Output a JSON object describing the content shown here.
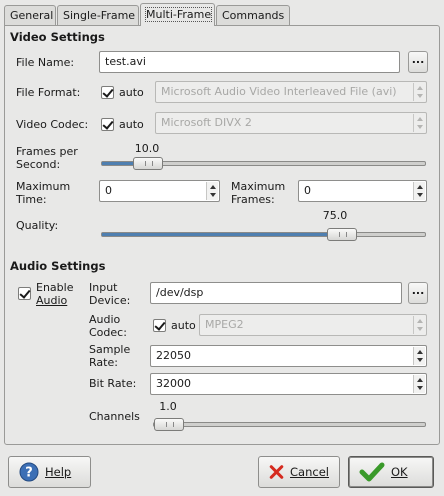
{
  "tabs": [
    "General",
    "Single-Frame",
    "Multi-Frame",
    "Commands"
  ],
  "video": {
    "title": "Video Settings",
    "file_name_label": "File Name:",
    "file_name_value": "test.avi",
    "browse_label": "...",
    "file_format_label": "File Format:",
    "auto_label": "auto",
    "file_format_value": "Microsoft Audio Video Interleaved File (avi)",
    "codec_label": "Video Codec:",
    "codec_value": "Microsoft DIVX 2",
    "fps_label_1": "Frames per",
    "fps_label_2": "Second:",
    "fps_value": "10.0",
    "fps_fraction": 0.0,
    "max_time_label_1": "Maximum",
    "max_time_label_2": "Time:",
    "max_time_value": "0",
    "max_frames_label_1": "Maximum",
    "max_frames_label_2": "Frames:",
    "max_frames_value": "0",
    "quality_label": "Quality:",
    "quality_value": "75.0",
    "quality_fraction": 0.75
  },
  "audio": {
    "title": "Audio Settings",
    "enable_label_1": "Enable",
    "enable_label_2": "Audio",
    "input_label_1": "Input",
    "input_label_2": "Device:",
    "input_value": "/dev/dsp",
    "browse_label": "...",
    "codec_label_1": "Audio",
    "codec_label_2": "Codec:",
    "auto_label": "auto",
    "codec_value": "MPEG2",
    "sample_label_1": "Sample",
    "sample_label_2": "Rate:",
    "sample_value": "22050",
    "bitrate_label": "Bit Rate:",
    "bitrate_value": "32000",
    "channels_label": "Channels",
    "channels_value": "1.0",
    "channels_fraction": 0.0
  },
  "buttons": {
    "help": "Help",
    "cancel": "Cancel",
    "ok": "OK"
  },
  "colors": {
    "slider_fill": "#4f7fb0",
    "ok_check": "#3a9a2a",
    "cancel_x": "#d52a1e",
    "help_circle": "#3c6fb5"
  }
}
